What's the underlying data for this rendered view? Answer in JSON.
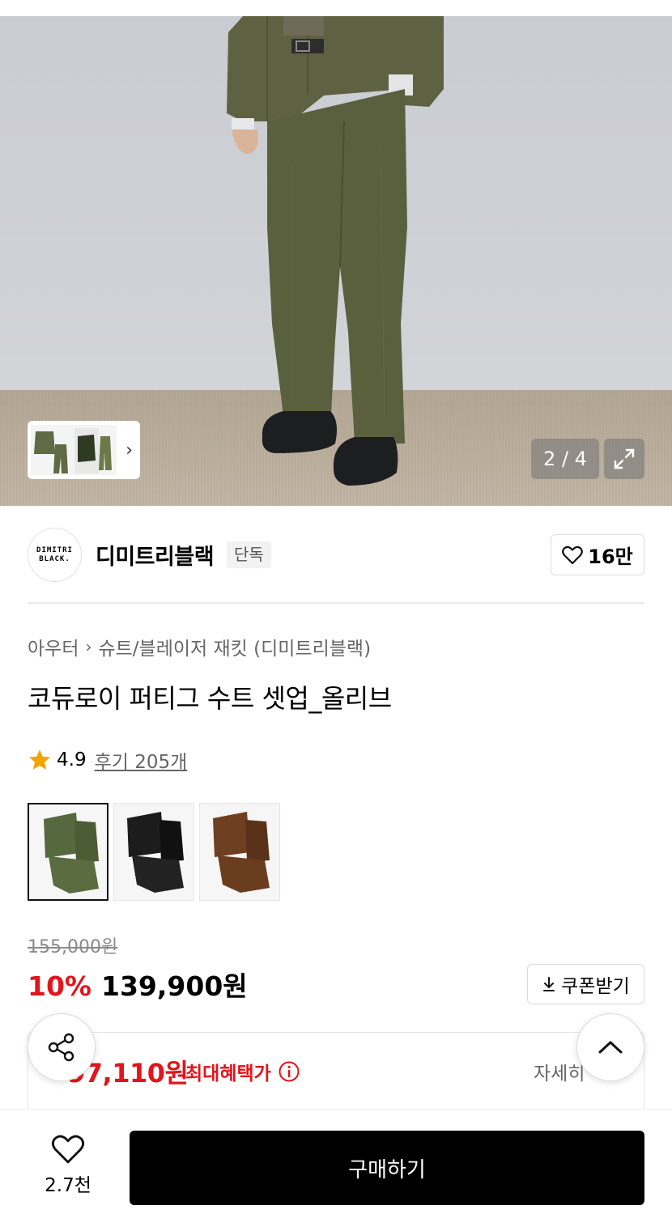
{
  "gallery": {
    "counter": "2 / 4",
    "current": 2,
    "total": 4
  },
  "brand": {
    "logo_line1": "DIMITRI",
    "logo_line2": "BLACK.",
    "name": "디미트리블랙",
    "badge": "단독",
    "likes": "16만"
  },
  "breadcrumb": {
    "category": "아우터",
    "subcategory": "슈트/블레이저 재킷 (디미트리블랙)"
  },
  "product": {
    "title": "코듀로이 퍼티그 수트 셋업_올리브",
    "rating": "4.9",
    "reviews": "후기 205개",
    "swatches": [
      {
        "name": "olive",
        "color": "#5a6b3f"
      },
      {
        "name": "black",
        "color": "#1e1e1e"
      },
      {
        "name": "brown",
        "color": "#6b3e22"
      }
    ],
    "selected_swatch": 0
  },
  "price": {
    "original": "155,000원",
    "discount": "10%",
    "sale": "139,900원",
    "coupon_label": "쿠폰받기"
  },
  "benefit": {
    "amount": "97,110원",
    "label": "최대혜택가",
    "detail": "자세히"
  },
  "bottom": {
    "wish_count": "2.7천",
    "buy_label": "구매하기"
  },
  "colors": {
    "accent_red": "#e2141c",
    "buy_button": "#000000"
  }
}
